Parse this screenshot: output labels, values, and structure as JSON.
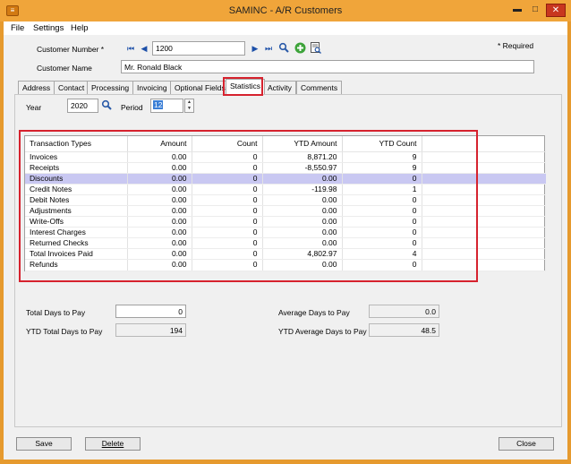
{
  "window": {
    "title": "SAMINC - A/R Customers",
    "minimize": "▬",
    "maximize": "□",
    "close": "✕"
  },
  "menu": [
    "File",
    "Settings",
    "Help"
  ],
  "header": {
    "customer_number_label": "Customer Number *",
    "customer_number_value": "1200",
    "customer_name_label": "Customer Name",
    "customer_name_value": "Mr. Ronald Black",
    "required_note": "* Required"
  },
  "icons": {
    "first": "⏮",
    "prev": "◀",
    "next": "▶",
    "last": "⏭",
    "find": "🔍",
    "new": "+",
    "zoom": "▤"
  },
  "tabs": [
    "Address",
    "Contact",
    "Processing",
    "Invoicing",
    "Optional Fields",
    "Statistics",
    "Activity",
    "Comments"
  ],
  "active_tab": "Statistics",
  "period_select": {
    "year_label": "Year",
    "year_value": "2020",
    "period_label": "Period",
    "period_value": "12"
  },
  "stats_table": {
    "columns": [
      "Transaction Types",
      "Amount",
      "Count",
      "YTD Amount",
      "YTD Count"
    ],
    "rows": [
      [
        "Invoices",
        "0.00",
        "0",
        "8,871.20",
        "9"
      ],
      [
        "Receipts",
        "0.00",
        "0",
        "-8,550.97",
        "9"
      ],
      [
        "Discounts",
        "0.00",
        "0",
        "0.00",
        "0"
      ],
      [
        "Credit Notes",
        "0.00",
        "0",
        "-119.98",
        "1"
      ],
      [
        "Debit Notes",
        "0.00",
        "0",
        "0.00",
        "0"
      ],
      [
        "Adjustments",
        "0.00",
        "0",
        "0.00",
        "0"
      ],
      [
        "Write-Offs",
        "0.00",
        "0",
        "0.00",
        "0"
      ],
      [
        "Interest Charges",
        "0.00",
        "0",
        "0.00",
        "0"
      ],
      [
        "Returned Checks",
        "0.00",
        "0",
        "0.00",
        "0"
      ],
      [
        "Total Invoices Paid",
        "0.00",
        "0",
        "4,802.97",
        "4"
      ],
      [
        "Refunds",
        "0.00",
        "0",
        "0.00",
        "0"
      ]
    ],
    "selected_row": "Discounts"
  },
  "days_to_pay": {
    "total_label": "Total Days to Pay",
    "total_value": "0",
    "ytd_total_label": "YTD Total Days to Pay",
    "ytd_total_value": "194",
    "avg_label": "Average Days to Pay",
    "avg_value": "0.0",
    "ytd_avg_label": "YTD Average Days to Pay",
    "ytd_avg_value": "48.5"
  },
  "buttons": {
    "save": "Save",
    "delete": "Delete",
    "close": "Close"
  },
  "colors": {
    "title_bar": "#f0a53a",
    "highlight": "#d6222e",
    "selected_row": "#c9c8f2"
  }
}
